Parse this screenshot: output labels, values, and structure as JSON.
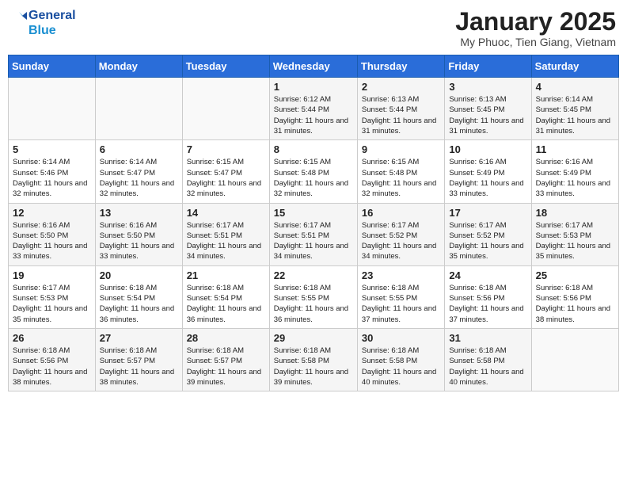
{
  "header": {
    "logo_line1": "General",
    "logo_line2": "Blue",
    "month": "January 2025",
    "location": "My Phuoc, Tien Giang, Vietnam"
  },
  "weekdays": [
    "Sunday",
    "Monday",
    "Tuesday",
    "Wednesday",
    "Thursday",
    "Friday",
    "Saturday"
  ],
  "weeks": [
    [
      {
        "day": "",
        "sunrise": "",
        "sunset": "",
        "daylight": ""
      },
      {
        "day": "",
        "sunrise": "",
        "sunset": "",
        "daylight": ""
      },
      {
        "day": "",
        "sunrise": "",
        "sunset": "",
        "daylight": ""
      },
      {
        "day": "1",
        "sunrise": "Sunrise: 6:12 AM",
        "sunset": "Sunset: 5:44 PM",
        "daylight": "Daylight: 11 hours and 31 minutes."
      },
      {
        "day": "2",
        "sunrise": "Sunrise: 6:13 AM",
        "sunset": "Sunset: 5:44 PM",
        "daylight": "Daylight: 11 hours and 31 minutes."
      },
      {
        "day": "3",
        "sunrise": "Sunrise: 6:13 AM",
        "sunset": "Sunset: 5:45 PM",
        "daylight": "Daylight: 11 hours and 31 minutes."
      },
      {
        "day": "4",
        "sunrise": "Sunrise: 6:14 AM",
        "sunset": "Sunset: 5:45 PM",
        "daylight": "Daylight: 11 hours and 31 minutes."
      }
    ],
    [
      {
        "day": "5",
        "sunrise": "Sunrise: 6:14 AM",
        "sunset": "Sunset: 5:46 PM",
        "daylight": "Daylight: 11 hours and 32 minutes."
      },
      {
        "day": "6",
        "sunrise": "Sunrise: 6:14 AM",
        "sunset": "Sunset: 5:47 PM",
        "daylight": "Daylight: 11 hours and 32 minutes."
      },
      {
        "day": "7",
        "sunrise": "Sunrise: 6:15 AM",
        "sunset": "Sunset: 5:47 PM",
        "daylight": "Daylight: 11 hours and 32 minutes."
      },
      {
        "day": "8",
        "sunrise": "Sunrise: 6:15 AM",
        "sunset": "Sunset: 5:48 PM",
        "daylight": "Daylight: 11 hours and 32 minutes."
      },
      {
        "day": "9",
        "sunrise": "Sunrise: 6:15 AM",
        "sunset": "Sunset: 5:48 PM",
        "daylight": "Daylight: 11 hours and 32 minutes."
      },
      {
        "day": "10",
        "sunrise": "Sunrise: 6:16 AM",
        "sunset": "Sunset: 5:49 PM",
        "daylight": "Daylight: 11 hours and 33 minutes."
      },
      {
        "day": "11",
        "sunrise": "Sunrise: 6:16 AM",
        "sunset": "Sunset: 5:49 PM",
        "daylight": "Daylight: 11 hours and 33 minutes."
      }
    ],
    [
      {
        "day": "12",
        "sunrise": "Sunrise: 6:16 AM",
        "sunset": "Sunset: 5:50 PM",
        "daylight": "Daylight: 11 hours and 33 minutes."
      },
      {
        "day": "13",
        "sunrise": "Sunrise: 6:16 AM",
        "sunset": "Sunset: 5:50 PM",
        "daylight": "Daylight: 11 hours and 33 minutes."
      },
      {
        "day": "14",
        "sunrise": "Sunrise: 6:17 AM",
        "sunset": "Sunset: 5:51 PM",
        "daylight": "Daylight: 11 hours and 34 minutes."
      },
      {
        "day": "15",
        "sunrise": "Sunrise: 6:17 AM",
        "sunset": "Sunset: 5:51 PM",
        "daylight": "Daylight: 11 hours and 34 minutes."
      },
      {
        "day": "16",
        "sunrise": "Sunrise: 6:17 AM",
        "sunset": "Sunset: 5:52 PM",
        "daylight": "Daylight: 11 hours and 34 minutes."
      },
      {
        "day": "17",
        "sunrise": "Sunrise: 6:17 AM",
        "sunset": "Sunset: 5:52 PM",
        "daylight": "Daylight: 11 hours and 35 minutes."
      },
      {
        "day": "18",
        "sunrise": "Sunrise: 6:17 AM",
        "sunset": "Sunset: 5:53 PM",
        "daylight": "Daylight: 11 hours and 35 minutes."
      }
    ],
    [
      {
        "day": "19",
        "sunrise": "Sunrise: 6:17 AM",
        "sunset": "Sunset: 5:53 PM",
        "daylight": "Daylight: 11 hours and 35 minutes."
      },
      {
        "day": "20",
        "sunrise": "Sunrise: 6:18 AM",
        "sunset": "Sunset: 5:54 PM",
        "daylight": "Daylight: 11 hours and 36 minutes."
      },
      {
        "day": "21",
        "sunrise": "Sunrise: 6:18 AM",
        "sunset": "Sunset: 5:54 PM",
        "daylight": "Daylight: 11 hours and 36 minutes."
      },
      {
        "day": "22",
        "sunrise": "Sunrise: 6:18 AM",
        "sunset": "Sunset: 5:55 PM",
        "daylight": "Daylight: 11 hours and 36 minutes."
      },
      {
        "day": "23",
        "sunrise": "Sunrise: 6:18 AM",
        "sunset": "Sunset: 5:55 PM",
        "daylight": "Daylight: 11 hours and 37 minutes."
      },
      {
        "day": "24",
        "sunrise": "Sunrise: 6:18 AM",
        "sunset": "Sunset: 5:56 PM",
        "daylight": "Daylight: 11 hours and 37 minutes."
      },
      {
        "day": "25",
        "sunrise": "Sunrise: 6:18 AM",
        "sunset": "Sunset: 5:56 PM",
        "daylight": "Daylight: 11 hours and 38 minutes."
      }
    ],
    [
      {
        "day": "26",
        "sunrise": "Sunrise: 6:18 AM",
        "sunset": "Sunset: 5:56 PM",
        "daylight": "Daylight: 11 hours and 38 minutes."
      },
      {
        "day": "27",
        "sunrise": "Sunrise: 6:18 AM",
        "sunset": "Sunset: 5:57 PM",
        "daylight": "Daylight: 11 hours and 38 minutes."
      },
      {
        "day": "28",
        "sunrise": "Sunrise: 6:18 AM",
        "sunset": "Sunset: 5:57 PM",
        "daylight": "Daylight: 11 hours and 39 minutes."
      },
      {
        "day": "29",
        "sunrise": "Sunrise: 6:18 AM",
        "sunset": "Sunset: 5:58 PM",
        "daylight": "Daylight: 11 hours and 39 minutes."
      },
      {
        "day": "30",
        "sunrise": "Sunrise: 6:18 AM",
        "sunset": "Sunset: 5:58 PM",
        "daylight": "Daylight: 11 hours and 40 minutes."
      },
      {
        "day": "31",
        "sunrise": "Sunrise: 6:18 AM",
        "sunset": "Sunset: 5:58 PM",
        "daylight": "Daylight: 11 hours and 40 minutes."
      },
      {
        "day": "",
        "sunrise": "",
        "sunset": "",
        "daylight": ""
      }
    ]
  ]
}
